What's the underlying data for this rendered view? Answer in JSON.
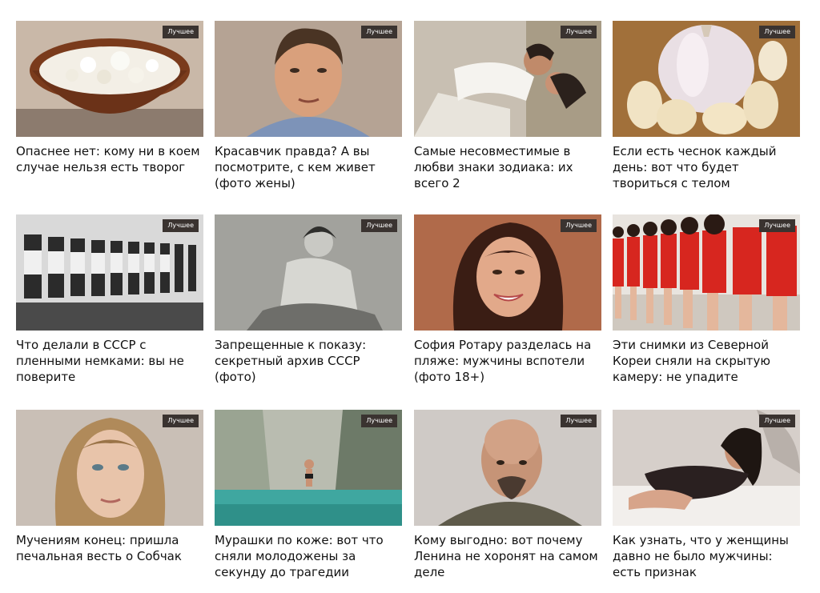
{
  "badge_label": "Лучшее",
  "cards": [
    {
      "title": "Опаснее нет: кому ни в коем случае нельзя есть творог",
      "image": "cottage-cheese-bowl"
    },
    {
      "title": "Красавчик правда? А вы посмотрите, с кем живет (фото жены)",
      "image": "man-portrait"
    },
    {
      "title": "Самые несовместимые в любви знаки зодиака: их всего 2",
      "image": "couple-kissing"
    },
    {
      "title": "Если есть чеснок каждый день: вот что будет твориться с телом",
      "image": "garlic-bulb"
    },
    {
      "title": "Что делали в СССР с пленными немками: вы не поверите",
      "image": "bw-women-row"
    },
    {
      "title": "Запрещенные к показу: секретный архив СССР (фото)",
      "image": "bw-woman-archive"
    },
    {
      "title": "София Ротару разделась на пляже: мужчины вспотели (фото 18+)",
      "image": "woman-smiling"
    },
    {
      "title": "Эти снимки из Северной Кореи сняли на скрытую камеру: не упадите",
      "image": "women-red-dresses"
    },
    {
      "title": "Мучениям конец: пришла печальная весть о Собчак",
      "image": "woman-portrait"
    },
    {
      "title": "Мурашки по коже: вот что сняли молодожены за секунду до трагедии",
      "image": "woman-waterfall"
    },
    {
      "title": "Кому выгодно: вот почему Ленина не хоронят на самом деле",
      "image": "bald-man-portrait"
    },
    {
      "title": "Как узнать, что у женщины давно не было мужчины: есть признак",
      "image": "woman-lying"
    }
  ]
}
